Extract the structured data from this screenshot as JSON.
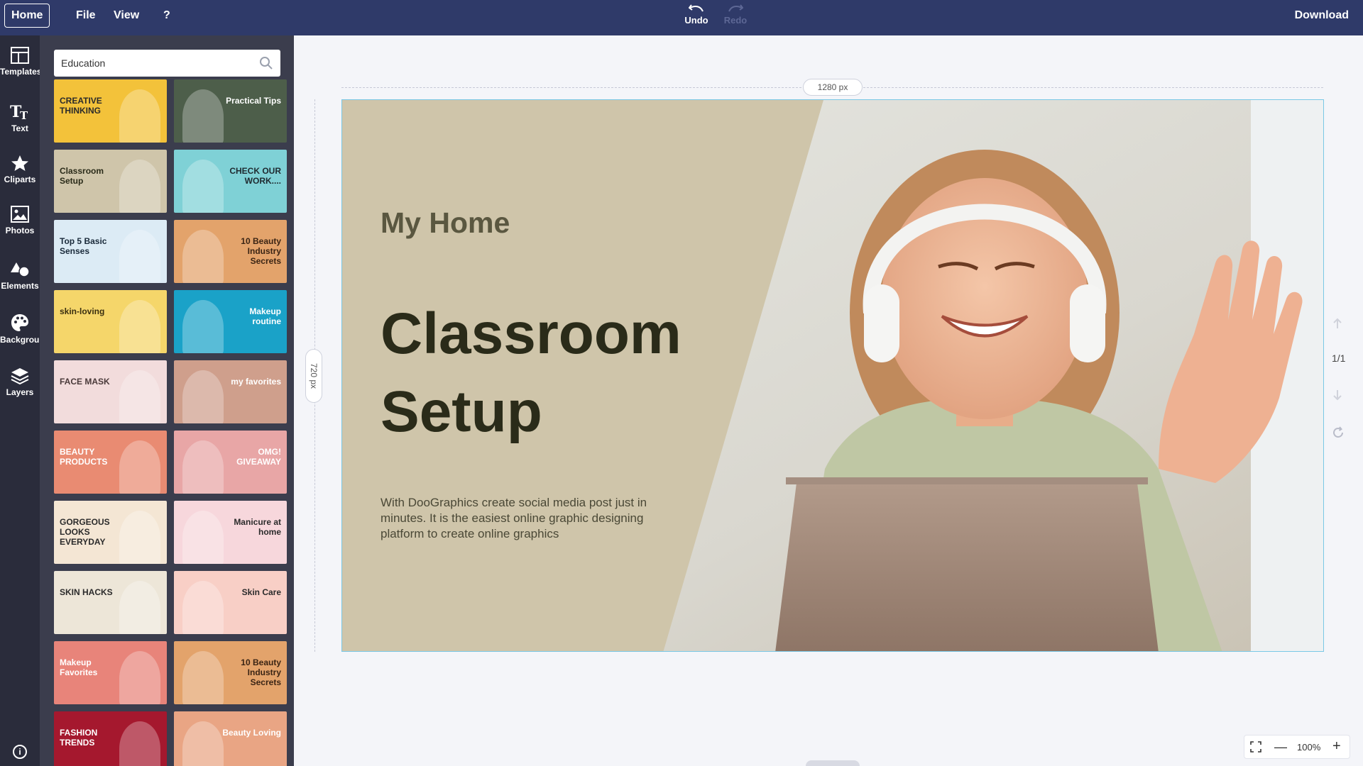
{
  "topbar": {
    "home_label": "Home",
    "menu": [
      "File",
      "View",
      "?"
    ],
    "undo_label": "Undo",
    "redo_label": "Redo",
    "download_label": "Download"
  },
  "rail": {
    "items": [
      {
        "label": "Templates",
        "icon": "templates-icon"
      },
      {
        "label": "Text",
        "icon": "text-icon"
      },
      {
        "label": "Cliparts",
        "icon": "star-icon"
      },
      {
        "label": "Photos",
        "icon": "photo-icon"
      },
      {
        "label": "Elements",
        "icon": "shapes-icon"
      },
      {
        "label": "Background",
        "icon": "palette-icon"
      },
      {
        "label": "Layers",
        "icon": "layers-icon"
      }
    ],
    "info_label": "i"
  },
  "panel": {
    "search_value": "Education",
    "templates": [
      {
        "title": "CREATIVE THINKING",
        "bg": "#f3c23a",
        "fg": "#2b2b2b"
      },
      {
        "title": "Practical Tips",
        "bg": "#4d5e4a",
        "fg": "#ffffff"
      },
      {
        "title": "Classroom Setup",
        "bg": "#cfc5aa",
        "fg": "#2a2b19"
      },
      {
        "title": "CHECK OUR WORK....",
        "bg": "#7fd1d6",
        "fg": "#1f2a30"
      },
      {
        "title": "Top 5 Basic Senses",
        "bg": "#dcebf5",
        "fg": "#1a2a3a"
      },
      {
        "title": "10 Beauty Industry Secrets",
        "bg": "#e3a36b",
        "fg": "#3a2414"
      },
      {
        "title": "skin-loving",
        "bg": "#f5d66a",
        "fg": "#3a2f10"
      },
      {
        "title": "Makeup routine",
        "bg": "#1aa2c8",
        "fg": "#ffffff"
      },
      {
        "title": "FACE MASK",
        "bg": "#f2dcdc",
        "fg": "#4a3a3a"
      },
      {
        "title": "my favorites",
        "bg": "#cf9f8c",
        "fg": "#ffffff"
      },
      {
        "title": "BEAUTY PRODUCTS",
        "bg": "#e98b72",
        "fg": "#ffffff"
      },
      {
        "title": "OMG! GIVEAWAY",
        "bg": "#e8a6a6",
        "fg": "#ffffff"
      },
      {
        "title": "GORGEOUS LOOKS EVERYDAY",
        "bg": "#f4e6d4",
        "fg": "#2b2b2b"
      },
      {
        "title": "Manicure at home",
        "bg": "#f7d7dc",
        "fg": "#2b2b2b"
      },
      {
        "title": "SKIN HACKS",
        "bg": "#ede6d8",
        "fg": "#2b2b2b"
      },
      {
        "title": "Skin Care",
        "bg": "#f8cfc6",
        "fg": "#2b2b2b"
      },
      {
        "title": "Makeup Favorites",
        "bg": "#e8847a",
        "fg": "#ffffff"
      },
      {
        "title": "10 Beauty Industry Secrets",
        "bg": "#e3a36b",
        "fg": "#3a2414"
      },
      {
        "title": "FASHION TRENDS",
        "bg": "#a5182e",
        "fg": "#ffffff"
      },
      {
        "title": "Beauty Loving",
        "bg": "#e9a584",
        "fg": "#ffffff"
      }
    ]
  },
  "canvas": {
    "width_label": "1280 px",
    "height_label": "720 px",
    "subtitle": "My Home",
    "title_line1": "Classroom",
    "title_line2": "Setup",
    "body": "With DooGraphics create social media post just in minutes. It is the easiest online graphic designing platform to create online graphics",
    "bg_color": "#cfc5aa"
  },
  "side_controls": {
    "page_indicator": "1/1"
  },
  "zoom": {
    "value": "100%"
  }
}
